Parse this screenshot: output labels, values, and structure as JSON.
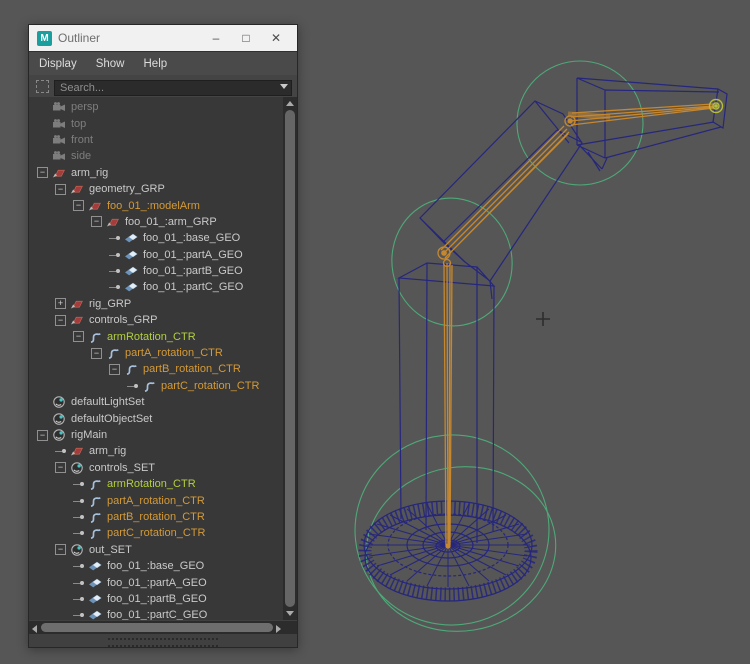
{
  "window": {
    "title": "Outliner",
    "app_icon_letter": "M",
    "buttons": {
      "minimize": "–",
      "maximize": "□",
      "close": "✕"
    },
    "menus": [
      "Display",
      "Show",
      "Help"
    ],
    "search": {
      "placeholder": "Search...",
      "value": ""
    }
  },
  "tree": {
    "rows": [
      {
        "label": "persp",
        "depth": 0,
        "icon": "camera",
        "expander": "none",
        "color": "gray"
      },
      {
        "label": "top",
        "depth": 0,
        "icon": "camera",
        "expander": "none",
        "color": "gray"
      },
      {
        "label": "front",
        "depth": 0,
        "icon": "camera",
        "expander": "none",
        "color": "gray"
      },
      {
        "label": "side",
        "depth": 0,
        "icon": "camera",
        "expander": "none",
        "color": "gray"
      },
      {
        "label": "arm_rig",
        "depth": 0,
        "icon": "transform",
        "expander": "minus",
        "color": "default"
      },
      {
        "label": "geometry_GRP",
        "depth": 1,
        "icon": "transform",
        "expander": "minus",
        "color": "default"
      },
      {
        "label": "foo_01_:modelArm",
        "depth": 2,
        "icon": "transform",
        "expander": "minus",
        "color": "orange"
      },
      {
        "label": "foo_01_:arm_GRP",
        "depth": 3,
        "icon": "transform",
        "expander": "minus",
        "color": "default"
      },
      {
        "label": "foo_01_:base_GEO",
        "depth": 4,
        "icon": "mesh",
        "expander": "leaf",
        "color": "default"
      },
      {
        "label": "foo_01_:partA_GEO",
        "depth": 4,
        "icon": "mesh",
        "expander": "leaf",
        "color": "default"
      },
      {
        "label": "foo_01_:partB_GEO",
        "depth": 4,
        "icon": "mesh",
        "expander": "leaf",
        "color": "default"
      },
      {
        "label": "foo_01_:partC_GEO",
        "depth": 4,
        "icon": "mesh",
        "expander": "leaf",
        "color": "default"
      },
      {
        "label": "rig_GRP",
        "depth": 1,
        "icon": "transform",
        "expander": "plus",
        "color": "default"
      },
      {
        "label": "controls_GRP",
        "depth": 1,
        "icon": "transform",
        "expander": "minus",
        "color": "default"
      },
      {
        "label": "armRotation_CTR",
        "depth": 2,
        "icon": "curve",
        "expander": "minus",
        "color": "green"
      },
      {
        "label": "partA_rotation_CTR",
        "depth": 3,
        "icon": "curve",
        "expander": "minus",
        "color": "orange"
      },
      {
        "label": "partB_rotation_CTR",
        "depth": 4,
        "icon": "curve",
        "expander": "minus",
        "color": "orange"
      },
      {
        "label": "partC_rotation_CTR",
        "depth": 5,
        "icon": "curve",
        "expander": "leaf",
        "color": "orange"
      },
      {
        "label": "defaultLightSet",
        "depth": 0,
        "icon": "set",
        "expander": "none",
        "color": "default"
      },
      {
        "label": "defaultObjectSet",
        "depth": 0,
        "icon": "set",
        "expander": "none",
        "color": "default"
      },
      {
        "label": "rigMain",
        "depth": 0,
        "icon": "set",
        "expander": "minus",
        "color": "default"
      },
      {
        "label": "arm_rig",
        "depth": 1,
        "icon": "transform",
        "expander": "leaf",
        "color": "default"
      },
      {
        "label": "controls_SET",
        "depth": 1,
        "icon": "set",
        "expander": "minus",
        "color": "default"
      },
      {
        "label": "armRotation_CTR",
        "depth": 2,
        "icon": "curve",
        "expander": "leaf",
        "color": "green"
      },
      {
        "label": "partA_rotation_CTR",
        "depth": 2,
        "icon": "curve",
        "expander": "leaf",
        "color": "orange"
      },
      {
        "label": "partB_rotation_CTR",
        "depth": 2,
        "icon": "curve",
        "expander": "leaf",
        "color": "orange"
      },
      {
        "label": "partC_rotation_CTR",
        "depth": 2,
        "icon": "curve",
        "expander": "leaf",
        "color": "orange"
      },
      {
        "label": "out_SET",
        "depth": 1,
        "icon": "set",
        "expander": "minus",
        "color": "default"
      },
      {
        "label": "foo_01_:base_GEO",
        "depth": 2,
        "icon": "mesh",
        "expander": "leaf",
        "color": "default"
      },
      {
        "label": "foo_01_:partA_GEO",
        "depth": 2,
        "icon": "mesh",
        "expander": "leaf",
        "color": "default"
      },
      {
        "label": "foo_01_:partB_GEO",
        "depth": 2,
        "icon": "mesh",
        "expander": "leaf",
        "color": "default"
      },
      {
        "label": "foo_01_:partC_GEO",
        "depth": 2,
        "icon": "mesh",
        "expander": "leaf",
        "color": "default"
      }
    ]
  },
  "viewport": {
    "background_color": "#5a5a5a",
    "wireframe_color": "#26267d",
    "rig_curve_color": "#c5872f",
    "control_circle_color": "#4fa879",
    "end_marker_color": "#b6bc3c",
    "visible_objects": [
      "base_GEO disc",
      "partA_GEO box",
      "partB_GEO box",
      "partC_GEO box",
      "rotation control circles",
      "rig curves",
      "end locator"
    ],
    "cursor_glyph": "+"
  }
}
